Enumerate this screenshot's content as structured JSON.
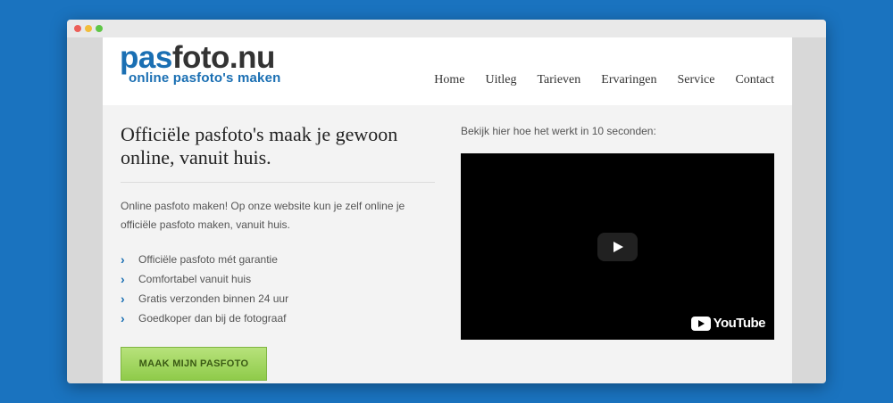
{
  "brand": {
    "logo_part1": "pas",
    "logo_part2": "foto.nu",
    "tagline": "online pasfoto's maken"
  },
  "nav": {
    "items": [
      "Home",
      "Uitleg",
      "Tarieven",
      "Ervaringen",
      "Service",
      "Contact"
    ]
  },
  "hero": {
    "headline": "Officiële pasfoto's maak je gewoon online, vanuit huis.",
    "intro": "Online pasfoto maken! Op onze website kun je zelf online je officiële pasfoto maken, vanuit huis.",
    "features": [
      "Officiële pasfoto mét garantie",
      "Comfortabel vanuit huis",
      "Gratis verzonden binnen 24 uur",
      "Goedkoper dan bij de fotograaf"
    ],
    "cta_label": "MAAK MIJN PASFOTO"
  },
  "video": {
    "caption": "Bekijk hier hoe het werkt in 10 seconden:",
    "brand_label": "YouTube"
  },
  "colors": {
    "background": "#1a73bf",
    "brand_blue": "#1a6fb3",
    "cta_green": "#9fd35a"
  },
  "icons": {
    "feature_bullet": "chevron-right-icon",
    "play": "play-icon",
    "video_brand": "youtube-icon"
  }
}
